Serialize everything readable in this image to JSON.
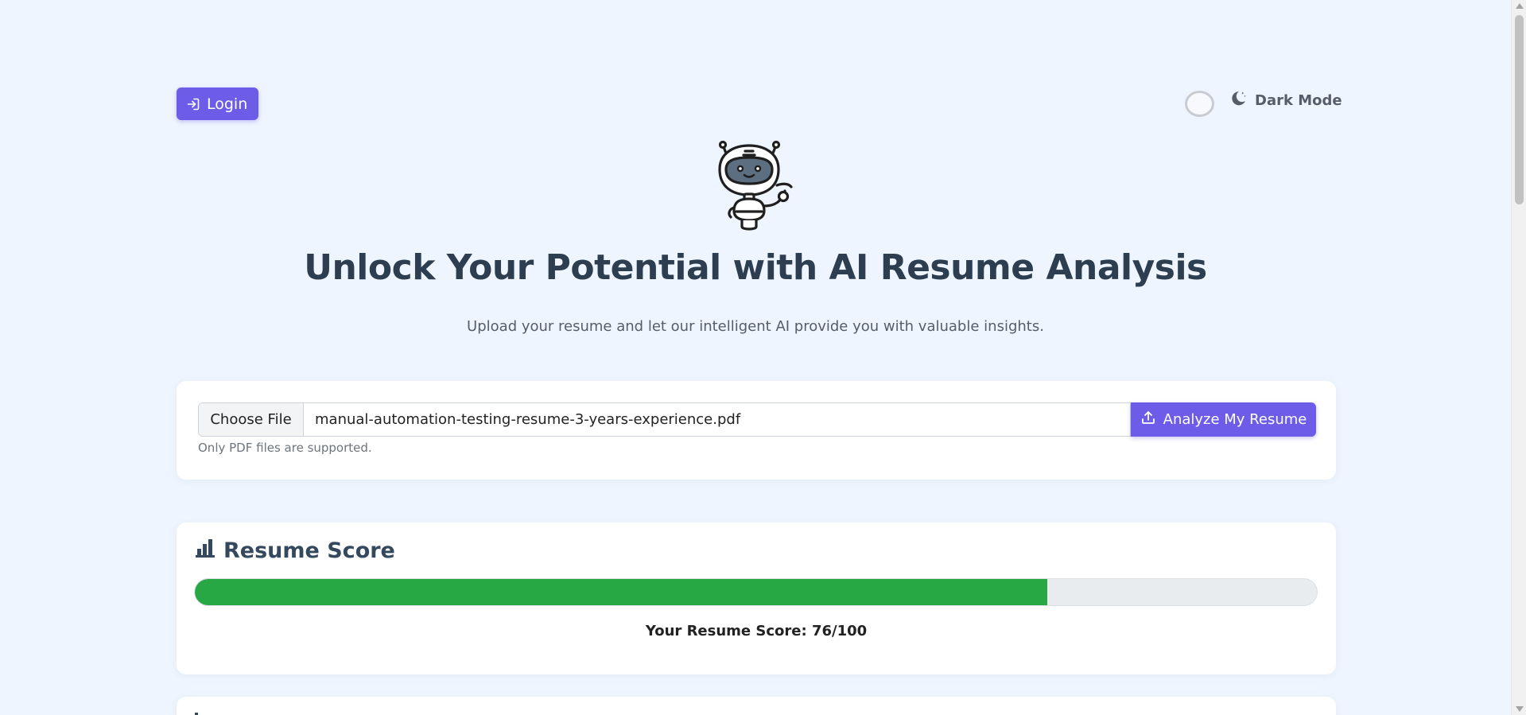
{
  "header": {
    "login_label": "Login",
    "dark_mode_label": "Dark Mode"
  },
  "hero": {
    "title": "Unlock Your Potential with AI Resume Analysis",
    "subtitle": "Upload your resume and let our intelligent AI provide you with valuable insights."
  },
  "upload": {
    "choose_file_label": "Choose File",
    "file_name": "manual-automation-testing-resume-3-years-experience.pdf",
    "analyze_label": "Analyze My Resume",
    "hint": "Only PDF files are supported."
  },
  "score": {
    "title": "Resume Score",
    "value": 76,
    "max": 100,
    "text": "Your Resume Score: 76/100"
  },
  "colors": {
    "accent": "#6c5ce7",
    "progress": "#28a745",
    "background": "#eef5fe"
  },
  "icons": {
    "login": "login-icon",
    "dark_mode": "moon-icon",
    "analyze": "upload-icon",
    "score": "bar-chart-icon",
    "mascot": "robot-icon"
  }
}
